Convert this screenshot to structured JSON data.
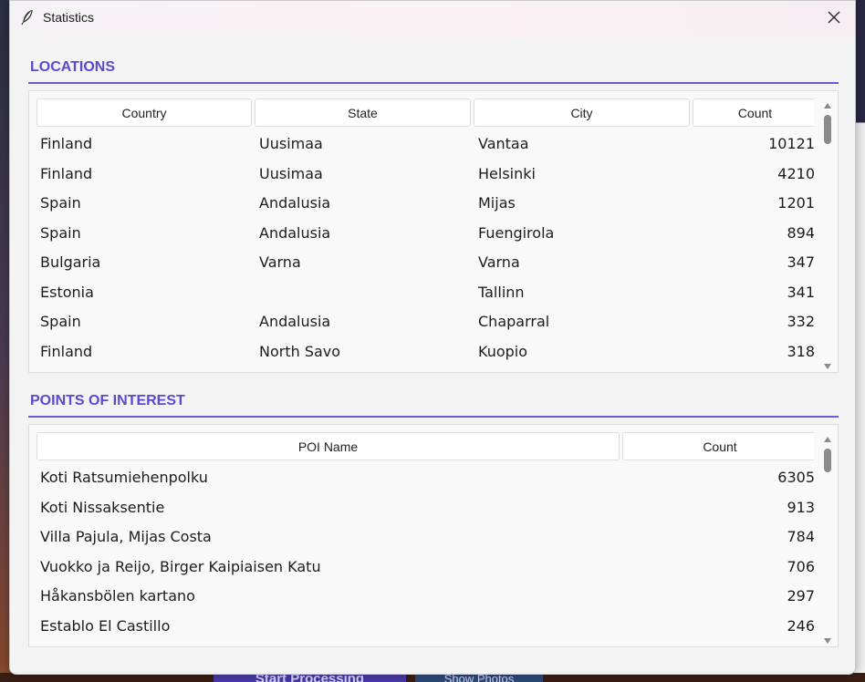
{
  "window": {
    "title": "Statistics"
  },
  "locations": {
    "heading": "LOCATIONS",
    "columns": [
      "Country",
      "State",
      "City",
      "Count"
    ],
    "rows": [
      {
        "country": "Finland",
        "state": "Uusimaa",
        "city": "Vantaa",
        "count": "10121"
      },
      {
        "country": "Finland",
        "state": "Uusimaa",
        "city": "Helsinki",
        "count": "4210"
      },
      {
        "country": "Spain",
        "state": "Andalusia",
        "city": "Mijas",
        "count": "1201"
      },
      {
        "country": "Spain",
        "state": "Andalusia",
        "city": "Fuengirola",
        "count": "894"
      },
      {
        "country": "Bulgaria",
        "state": "Varna",
        "city": "Varna",
        "count": "347"
      },
      {
        "country": "Estonia",
        "state": "",
        "city": "Tallinn",
        "count": "341"
      },
      {
        "country": "Spain",
        "state": "Andalusia",
        "city": "Chaparral",
        "count": "332"
      },
      {
        "country": "Finland",
        "state": "North Savo",
        "city": "Kuopio",
        "count": "318"
      }
    ]
  },
  "poi": {
    "heading": "POINTS OF INTEREST",
    "columns": [
      "POI Name",
      "Count"
    ],
    "rows": [
      {
        "name": "Koti Ratsumiehenpolku",
        "count": "6305"
      },
      {
        "name": "Koti Nissaksentie",
        "count": "913"
      },
      {
        "name": "Villa Pajula, Mijas Costa",
        "count": "784"
      },
      {
        "name": "Vuokko ja Reijo, Birger Kaipiaisen Katu",
        "count": "706"
      },
      {
        "name": "Håkansbölen kartano",
        "count": "297"
      },
      {
        "name": "Establo El Castillo",
        "count": "246"
      }
    ]
  },
  "background": {
    "start_button": "Start Processing",
    "photos_button": "Show Photos"
  },
  "icons": {
    "app": "feather-icon",
    "close": "close-icon",
    "scroll_up": "triangle-up-icon",
    "scroll_down": "triangle-down-icon"
  },
  "colors": {
    "accent": "#5a4ad0",
    "rule": "#6a5cd6"
  }
}
